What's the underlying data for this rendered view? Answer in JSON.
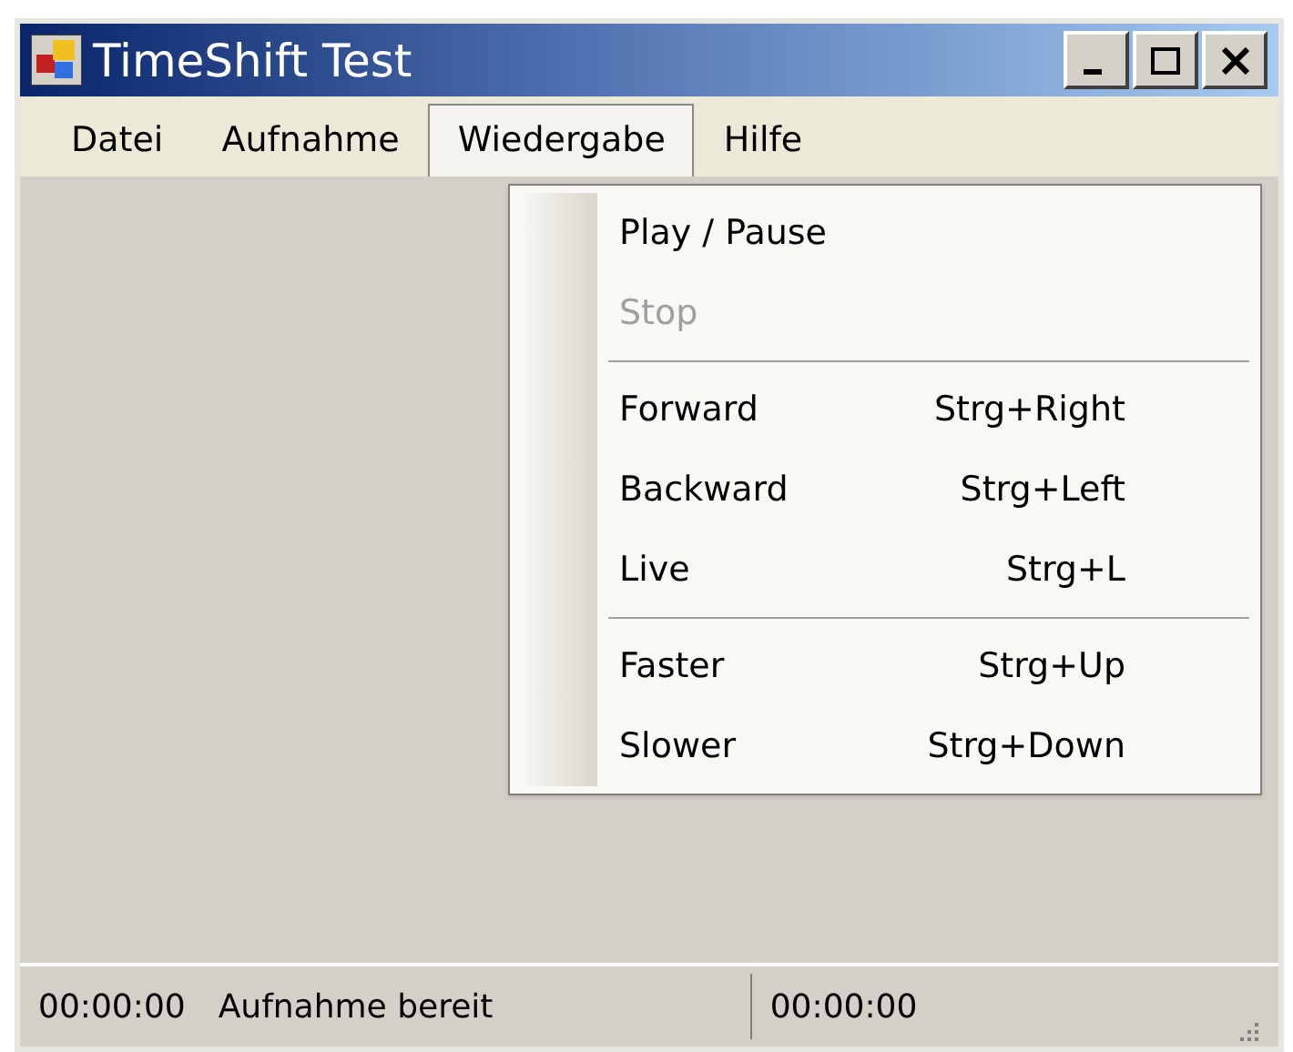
{
  "window": {
    "title": "TimeShift Test"
  },
  "menu_bar": [
    {
      "label": "Datei",
      "selected": false
    },
    {
      "label": "Aufnahme",
      "selected": false
    },
    {
      "label": "Wiedergabe",
      "selected": true
    },
    {
      "label": "Hilfe",
      "selected": false
    }
  ],
  "dropdown": {
    "items": [
      {
        "kind": "item",
        "label": "Play / Pause",
        "disabled": false
      },
      {
        "kind": "item",
        "label": "Stop",
        "disabled": true
      },
      {
        "kind": "separator"
      },
      {
        "kind": "item",
        "label": "Forward",
        "shortcut": "Strg+Right",
        "disabled": false
      },
      {
        "kind": "item",
        "label": "Backward",
        "shortcut": "Strg+Left",
        "disabled": false
      },
      {
        "kind": "item",
        "label": "Live",
        "shortcut": "Strg+L",
        "disabled": false
      },
      {
        "kind": "separator"
      },
      {
        "kind": "item",
        "label": "Faster",
        "shortcut": "Strg+Up",
        "disabled": false
      },
      {
        "kind": "item",
        "label": "Slower",
        "shortcut": "Strg+Down",
        "disabled": false
      }
    ]
  },
  "status_bar": {
    "time": "00:00:00",
    "message": "Aufnahme bereit",
    "position": "00:00:00"
  }
}
